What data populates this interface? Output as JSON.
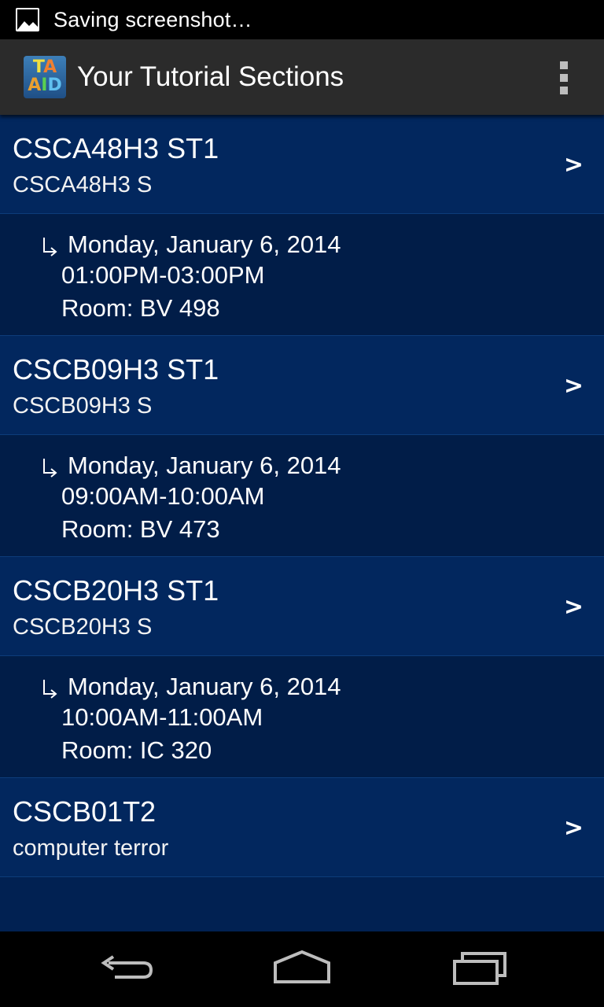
{
  "status_bar": {
    "notification_icon": "image-icon",
    "text": "Saving screenshot…"
  },
  "action_bar": {
    "icon_line1": "TA",
    "icon_line2": "AID",
    "title": "Your Tutorial Sections",
    "overflow_icon": "overflow-menu-icon"
  },
  "sections": [
    {
      "code": "CSCA48H3 ST1",
      "subtitle": "CSCA48H3 S",
      "chevron": ">",
      "date": "Monday, January 6, 2014",
      "time": "01:00PM-03:00PM",
      "room": "Room: BV 498"
    },
    {
      "code": "CSCB09H3 ST1",
      "subtitle": "CSCB09H3 S",
      "chevron": ">",
      "date": "Monday, January 6, 2014",
      "time": "09:00AM-10:00AM",
      "room": "Room: BV 473"
    },
    {
      "code": "CSCB20H3 ST1",
      "subtitle": "CSCB20H3 S",
      "chevron": ">",
      "date": "Monday, January 6, 2014",
      "time": "10:00AM-11:00AM",
      "room": "Room: IC 320"
    },
    {
      "code": "CSCB01T2",
      "subtitle": "computer terror",
      "chevron": ">"
    }
  ],
  "nav_bar": {
    "back_icon": "back-icon",
    "home_icon": "home-icon",
    "recents_icon": "recents-icon"
  },
  "colors": {
    "list_background": "#012152",
    "section_row": "#02275e",
    "detail_row": "#011d48",
    "divider": "#0d3c7a",
    "action_bar": "#2b2b2b"
  }
}
